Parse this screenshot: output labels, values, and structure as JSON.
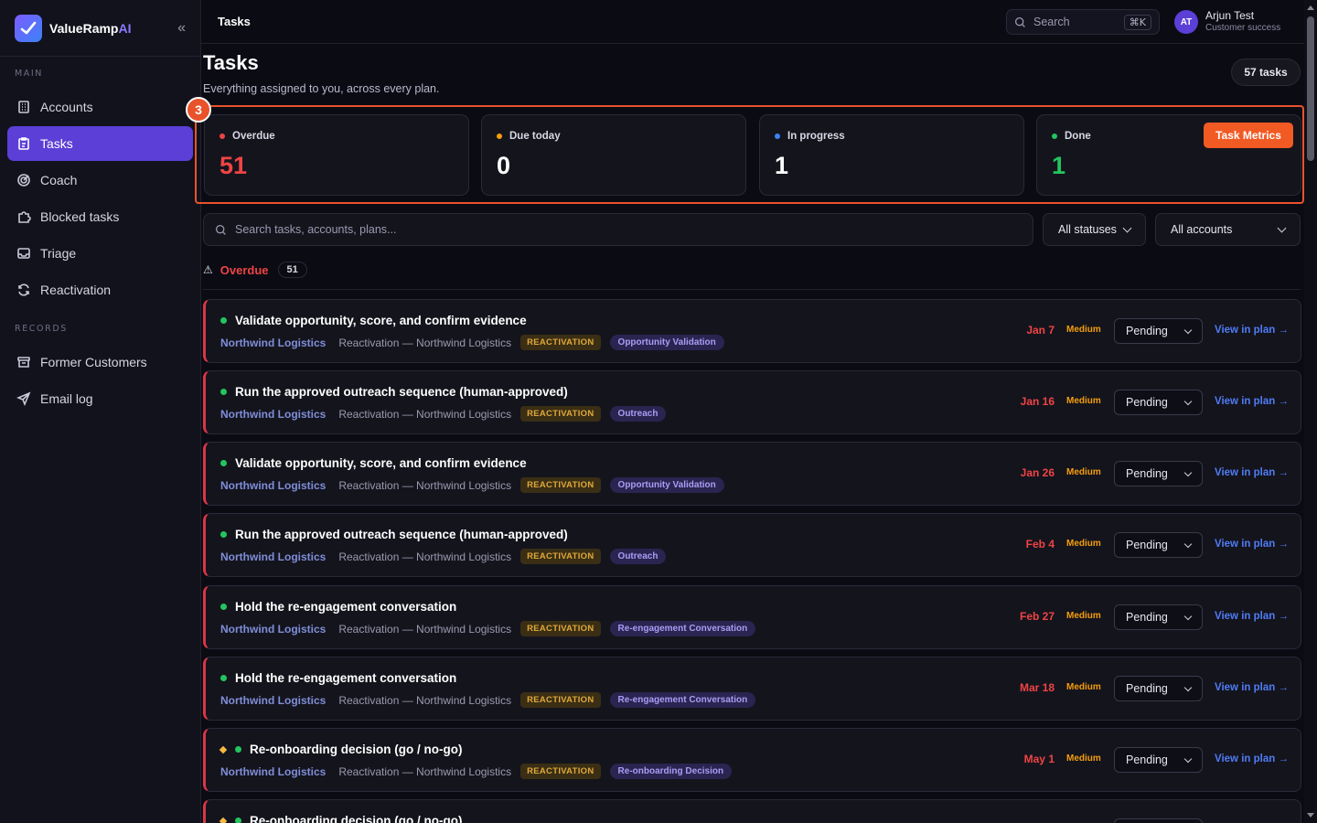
{
  "app": {
    "brand_main": "ValueRamp",
    "brand_ai": "AI",
    "collapse_glyph": "«"
  },
  "sidebar": {
    "main_label": "MAIN",
    "records_label": "RECORDS",
    "main_items": [
      {
        "label": "Accounts",
        "icon": "building-icon"
      },
      {
        "label": "Tasks",
        "icon": "clipboard-icon"
      },
      {
        "label": "Coach",
        "icon": "target-icon"
      },
      {
        "label": "Blocked tasks",
        "icon": "puzzle-icon"
      },
      {
        "label": "Triage",
        "icon": "inbox-icon"
      },
      {
        "label": "Reactivation",
        "icon": "refresh-icon"
      }
    ],
    "records_items": [
      {
        "label": "Former Customers",
        "icon": "archive-icon"
      },
      {
        "label": "Email log",
        "icon": "send-icon"
      }
    ]
  },
  "topbar": {
    "crumb": "Tasks",
    "search_placeholder": "Search",
    "search_shortcut": "⌘K",
    "user_initials": "AT",
    "user_name": "Arjun Test",
    "user_role": "Customer success"
  },
  "header": {
    "title": "Tasks",
    "subtitle": "Everything assigned to you, across every plan.",
    "count": "57 tasks",
    "step_badge": "3"
  },
  "stats": [
    {
      "label": "Overdue",
      "value": "51",
      "color": "#ef4444"
    },
    {
      "label": "Due today",
      "value": "0",
      "color": "#f59e0b"
    },
    {
      "label": "In progress",
      "value": "1",
      "color": "#3b82f6"
    },
    {
      "label": "Done",
      "value": "1",
      "color": "#22c55e"
    }
  ],
  "metrics_button": "Task Metrics",
  "filters": {
    "search_placeholder": "Search tasks, accounts, plans...",
    "status": "All statuses",
    "account": "All accounts"
  },
  "group": {
    "title": "Overdue",
    "count": "51",
    "warn_glyph": "⚠"
  },
  "tasks": [
    {
      "title": "Validate opportunity, score, and confirm evidence",
      "account": "Northwind Logistics",
      "plan": "Reactivation — Northwind Logistics",
      "tag": "REACTIVATION",
      "stage": "Opportunity Validation",
      "date": "Jan 7",
      "priority": "Medium",
      "status": "Pending",
      "link": "View in plan →",
      "flag": false
    },
    {
      "title": "Run the approved outreach sequence (human-approved)",
      "account": "Northwind Logistics",
      "plan": "Reactivation — Northwind Logistics",
      "tag": "REACTIVATION",
      "stage": "Outreach",
      "date": "Jan 16",
      "priority": "Medium",
      "status": "Pending",
      "link": "View in plan →",
      "flag": false
    },
    {
      "title": "Validate opportunity, score, and confirm evidence",
      "account": "Northwind Logistics",
      "plan": "Reactivation — Northwind Logistics",
      "tag": "REACTIVATION",
      "stage": "Opportunity Validation",
      "date": "Jan 26",
      "priority": "Medium",
      "status": "Pending",
      "link": "View in plan →",
      "flag": false
    },
    {
      "title": "Run the approved outreach sequence (human-approved)",
      "account": "Northwind Logistics",
      "plan": "Reactivation — Northwind Logistics",
      "tag": "REACTIVATION",
      "stage": "Outreach",
      "date": "Feb 4",
      "priority": "Medium",
      "status": "Pending",
      "link": "View in plan →",
      "flag": false
    },
    {
      "title": "Hold the re-engagement conversation",
      "account": "Northwind Logistics",
      "plan": "Reactivation — Northwind Logistics",
      "tag": "REACTIVATION",
      "stage": "Re-engagement Conversation",
      "date": "Feb 27",
      "priority": "Medium",
      "status": "Pending",
      "link": "View in plan →",
      "flag": false
    },
    {
      "title": "Hold the re-engagement conversation",
      "account": "Northwind Logistics",
      "plan": "Reactivation — Northwind Logistics",
      "tag": "REACTIVATION",
      "stage": "Re-engagement Conversation",
      "date": "Mar 18",
      "priority": "Medium",
      "status": "Pending",
      "link": "View in plan →",
      "flag": false
    },
    {
      "title": "Re-onboarding decision (go / no-go)",
      "account": "Northwind Logistics",
      "plan": "Reactivation — Northwind Logistics",
      "tag": "REACTIVATION",
      "stage": "Re-onboarding Decision",
      "date": "May 1",
      "priority": "Medium",
      "status": "Pending",
      "link": "View in plan →",
      "flag": true
    },
    {
      "title": "Re-onboarding decision (go / no-go)",
      "account": "",
      "plan": "",
      "tag": "",
      "stage": "",
      "date": "",
      "priority": "",
      "status": "",
      "link": "",
      "flag": true
    }
  ]
}
